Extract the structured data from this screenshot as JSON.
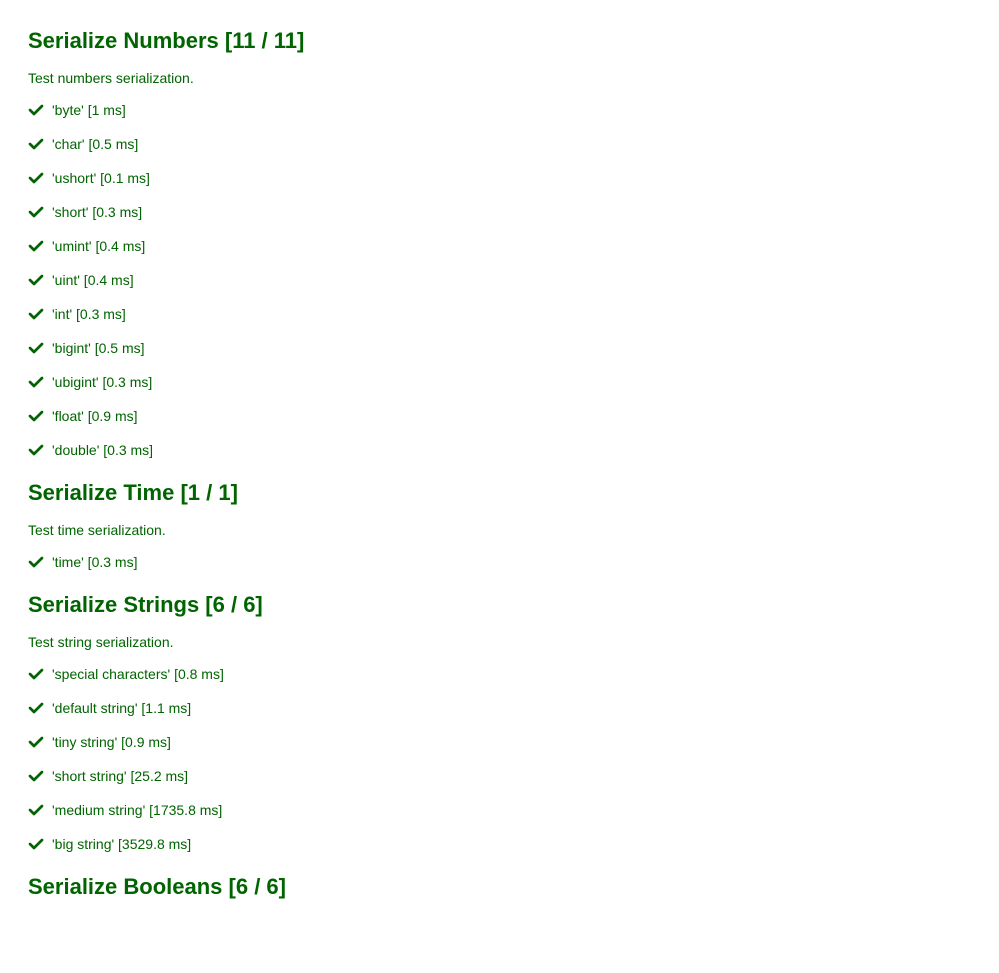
{
  "colors": {
    "green": "#006400"
  },
  "suites": [
    {
      "title": "Serialize Numbers [11 / 11]",
      "description": "Test numbers serialization.",
      "tests": [
        {
          "label": "'byte' [1 ms]"
        },
        {
          "label": "'char' [0.5 ms]"
        },
        {
          "label": "'ushort' [0.1 ms]"
        },
        {
          "label": "'short' [0.3 ms]"
        },
        {
          "label": "'umint' [0.4 ms]"
        },
        {
          "label": "'uint' [0.4 ms]"
        },
        {
          "label": "'int' [0.3 ms]"
        },
        {
          "label": "'bigint' [0.5 ms]"
        },
        {
          "label": "'ubigint' [0.3 ms]"
        },
        {
          "label": "'float' [0.9 ms]"
        },
        {
          "label": "'double' [0.3 ms]"
        }
      ]
    },
    {
      "title": "Serialize Time [1 / 1]",
      "description": "Test time serialization.",
      "tests": [
        {
          "label": "'time' [0.3 ms]"
        }
      ]
    },
    {
      "title": "Serialize Strings [6 / 6]",
      "description": "Test string serialization.",
      "tests": [
        {
          "label": "'special characters' [0.8 ms]"
        },
        {
          "label": "'default string' [1.1 ms]"
        },
        {
          "label": "'tiny string' [0.9 ms]"
        },
        {
          "label": "'short string' [25.2 ms]"
        },
        {
          "label": "'medium string' [1735.8 ms]"
        },
        {
          "label": "'big string' [3529.8 ms]"
        }
      ]
    },
    {
      "title": "Serialize Booleans [6 / 6]",
      "description": "",
      "tests": []
    }
  ]
}
